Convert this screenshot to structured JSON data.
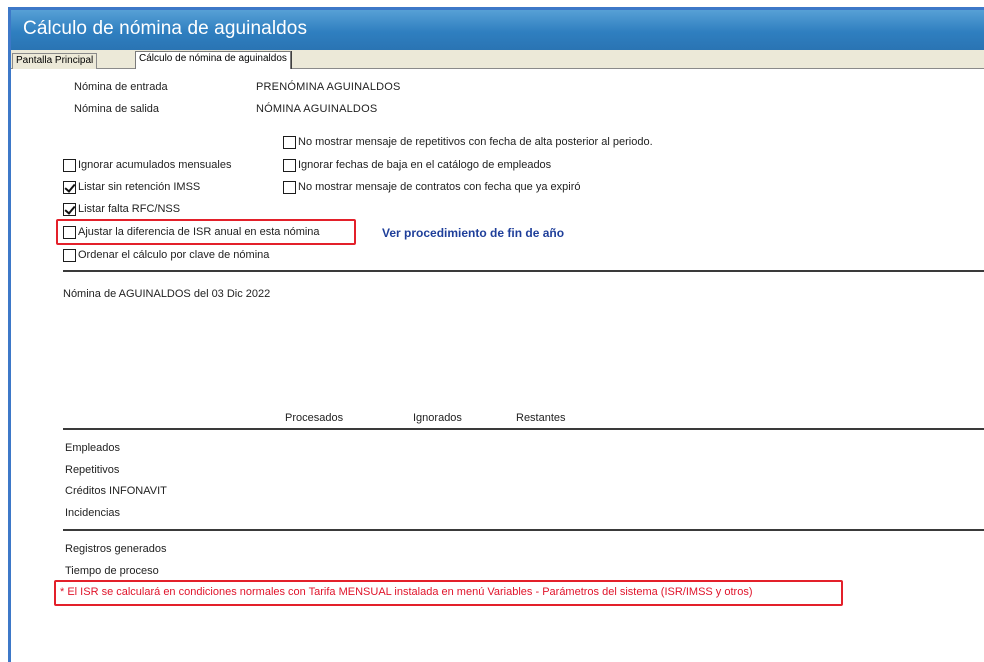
{
  "window": {
    "title": "Cálculo de nómina de aguinaldos"
  },
  "tabs": [
    {
      "label": "Pantalla Principal"
    },
    {
      "label": "Cálculo de nómina de aguinaldos"
    }
  ],
  "fields": {
    "input_label": "Nómina de entrada",
    "input_value": "PRENÓMINA AGUINALDOS",
    "output_label": "Nómina de salida",
    "output_value": "NÓMINA AGUINALDOS"
  },
  "options_right": [
    {
      "label": "No mostrar mensaje de repetitivos con fecha de alta posterior al periodo.",
      "checked": false
    },
    {
      "label": "Ignorar fechas de baja en el catálogo de empleados",
      "checked": false
    },
    {
      "label": "No mostrar mensaje de contratos con fecha que ya expiró",
      "checked": false
    }
  ],
  "options_left": [
    {
      "label": "Ignorar acumulados mensuales",
      "checked": false
    },
    {
      "label": "Listar sin retención IMSS",
      "checked": true
    },
    {
      "label": "Listar falta RFC/NSS",
      "checked": true
    },
    {
      "label": "Ajustar la diferencia de ISR anual en esta nómina",
      "checked": false
    },
    {
      "label": "Ordenar el cálculo por clave de nómina",
      "checked": false
    }
  ],
  "year_end_link": "Ver procedimiento de fin de año",
  "payroll_info": "Nómina de AGUINALDOS del 03 Dic 2022",
  "stats": {
    "columns": [
      "Procesados",
      "Ignorados",
      "Restantes"
    ],
    "rows": [
      "Empleados",
      "Repetitivos",
      "Créditos INFONAVIT",
      "Incidencias"
    ]
  },
  "summary": {
    "rows": [
      "Registros generados",
      "Tiempo de proceso"
    ]
  },
  "note": "* El ISR se calculará en condiciones normales con Tarifa MENSUAL instalada en menú Variables - Parámetros del sistema (ISR/IMSS y otros)",
  "colors": {
    "titlebar": "#2f7fc0",
    "highlight_border": "#e3202a",
    "link": "#1f3f9a",
    "note_text": "#e0142b"
  }
}
